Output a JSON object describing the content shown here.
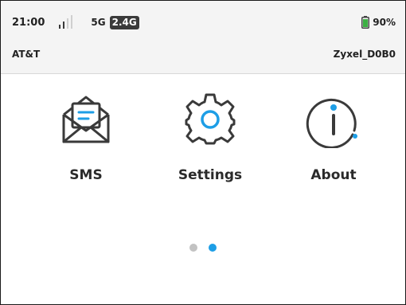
{
  "status": {
    "time": "21:00",
    "network": "5G",
    "band": "2.4G",
    "battery_percent": "90%",
    "battery_level": 0.9,
    "signal_bars_active": 2,
    "signal_bars_total": 4,
    "carrier": "AT&T",
    "ssid": "Zyxel_D0B0"
  },
  "apps": [
    {
      "label": "SMS",
      "icon": "envelope-icon"
    },
    {
      "label": "Settings",
      "icon": "gear-icon"
    },
    {
      "label": "About",
      "icon": "info-icon"
    }
  ],
  "pager": {
    "pages": 2,
    "active_index": 1
  },
  "colors": {
    "accent": "#1d9ee6",
    "icon_stroke": "#3a3a3a",
    "battery_green": "#3cb043",
    "dot_inactive": "#c2c2c2",
    "status_bar_bg": "#f4f4f4"
  }
}
